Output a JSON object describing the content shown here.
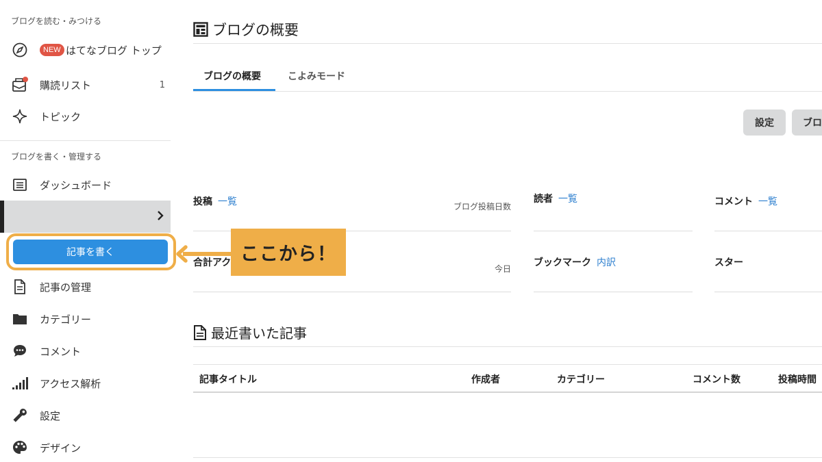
{
  "sidebar": {
    "section_read": "ブログを読む・みつける",
    "new_badge": "NEW",
    "hatena_top": "はてなブログ トップ",
    "subscribe": "購読リスト",
    "subscribe_count": "1",
    "topic": "トピック",
    "section_write": "ブログを書く・管理する",
    "dashboard": "ダッシュボード",
    "write_button": "記事を書く",
    "manage": "記事の管理",
    "category": "カテゴリー",
    "comment": "コメント",
    "access": "アクセス解析",
    "settings": "設定",
    "design": "デザイン"
  },
  "callout": {
    "text": "ここから！"
  },
  "main": {
    "title": "ブログの概要",
    "tabs": [
      {
        "label": "ブログの概要"
      },
      {
        "label": "こよみモード"
      }
    ],
    "buttons": {
      "settings": "設定",
      "blog": "ブロ"
    },
    "stats": {
      "posts": "投稿",
      "posts_link": "一覧",
      "posts_sub": "ブログ投稿日数",
      "readers": "読者",
      "readers_link": "一覧",
      "comments": "コメント",
      "comments_link": "一覧",
      "total": "合計アク",
      "total_sub": "今日",
      "bookmarks": "ブックマーク",
      "bookmarks_link": "内訳",
      "stars": "スター"
    },
    "recent_title": "最近書いた記事",
    "table_headers": [
      "記事タイトル",
      "作成者",
      "カテゴリー",
      "コメント数",
      "投稿時間"
    ]
  },
  "colors": {
    "accent": "#2d8fe0",
    "callout": "#efae48",
    "badge": "#e05545",
    "link": "#2d7fcf"
  }
}
